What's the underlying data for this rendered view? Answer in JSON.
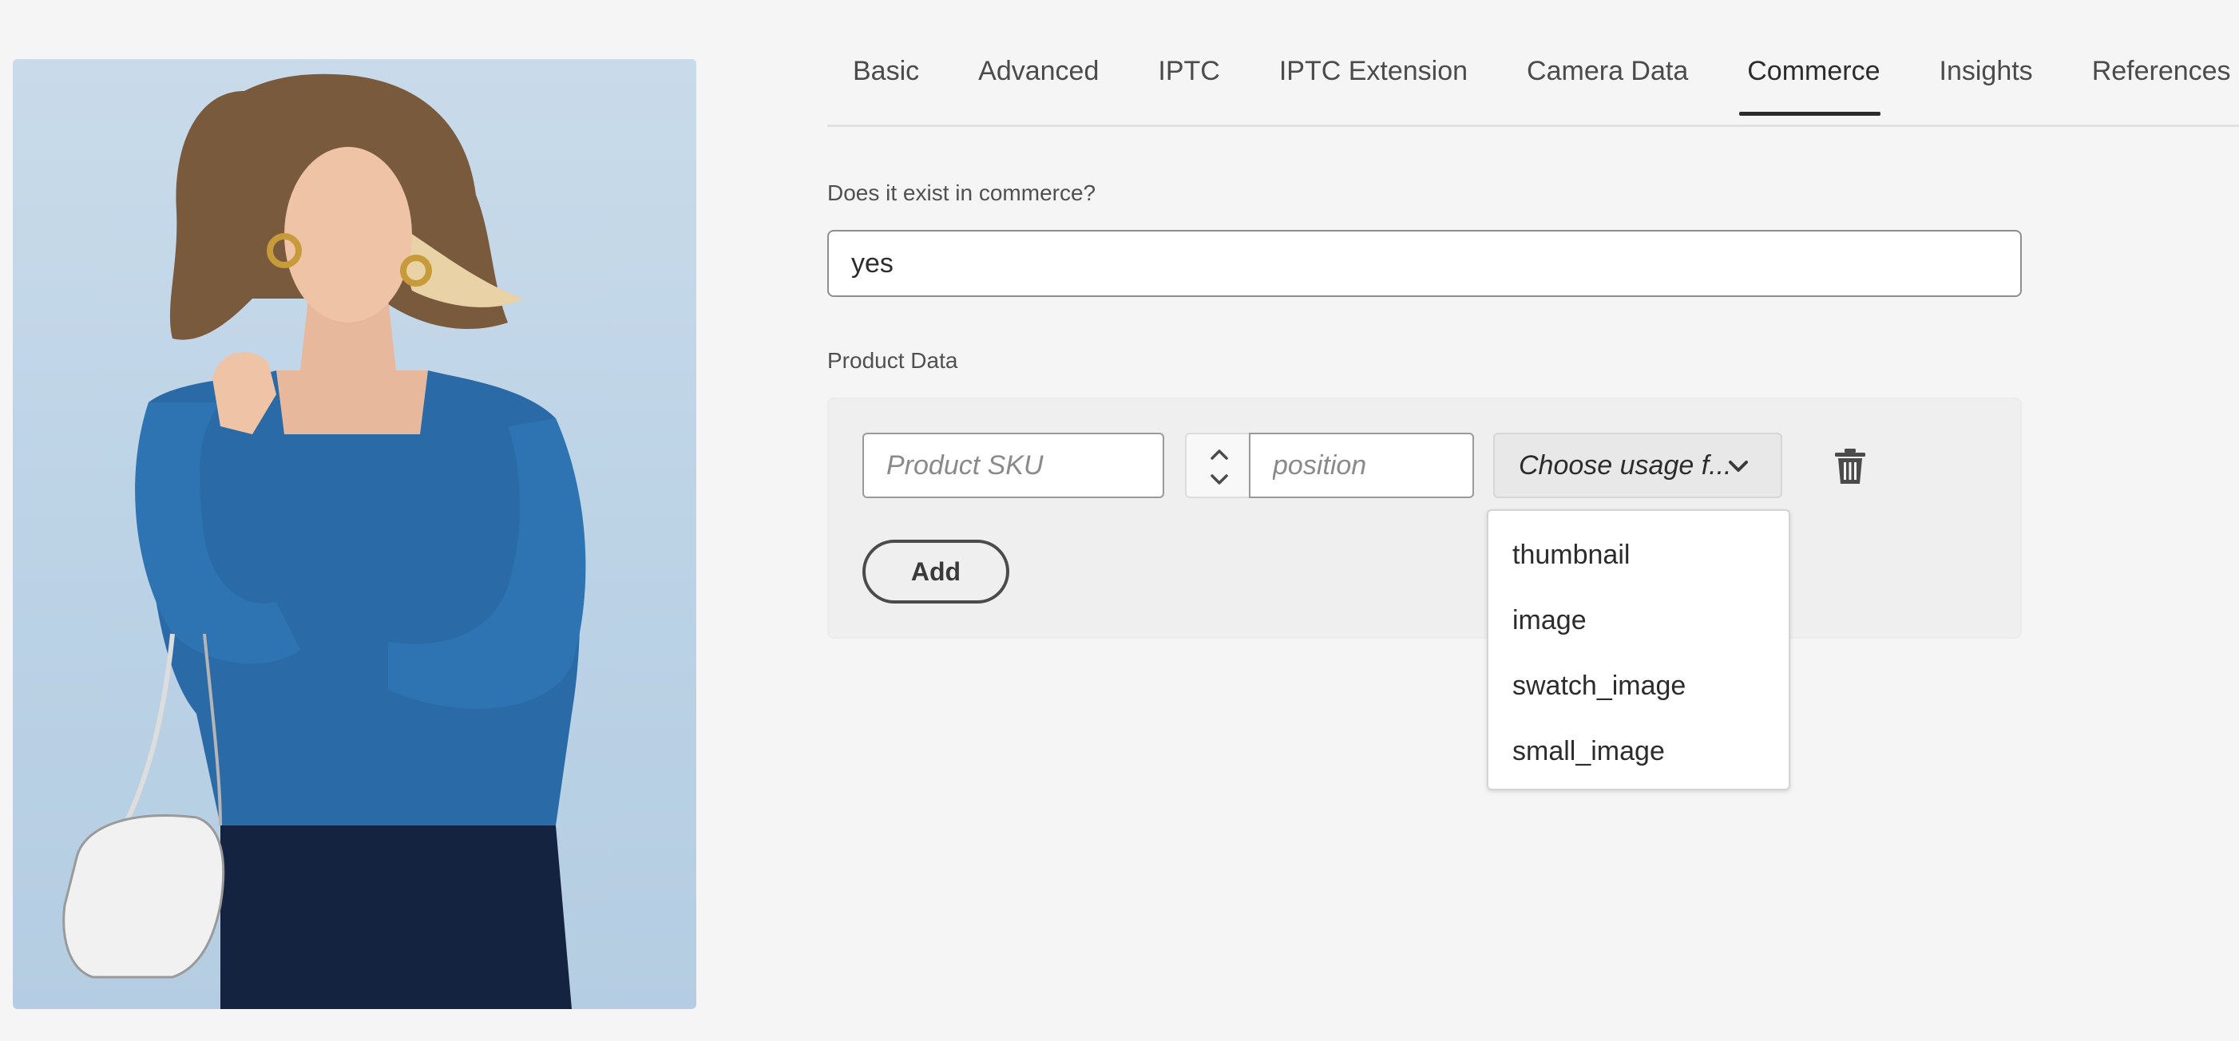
{
  "tabs": [
    {
      "label": "Basic"
    },
    {
      "label": "Advanced"
    },
    {
      "label": "IPTC"
    },
    {
      "label": "IPTC Extension"
    },
    {
      "label": "Camera Data"
    },
    {
      "label": "Commerce"
    },
    {
      "label": "Insights"
    },
    {
      "label": "References"
    }
  ],
  "active_tab": "Commerce",
  "commerce": {
    "exists_label": "Does it exist in commerce?",
    "exists_value": "yes",
    "product_data_label": "Product Data",
    "sku_placeholder": "Product SKU",
    "position_placeholder": "position",
    "usage_picker_value": "Choose usage f...",
    "add_label": "Add",
    "usage_options": [
      "thumbnail",
      "image",
      "swatch_image",
      "small_image"
    ]
  },
  "icons": {
    "stepper": "chevron-up-down-icon",
    "picker": "chevron-down-icon",
    "delete": "trash-icon"
  },
  "colors": {
    "background": "#f5f5f5",
    "text": "#2c2c2c",
    "active_tab_underline": "#2c2c2c",
    "photo_background": "#c3d7e8",
    "sweater": "#2a6aa6"
  }
}
